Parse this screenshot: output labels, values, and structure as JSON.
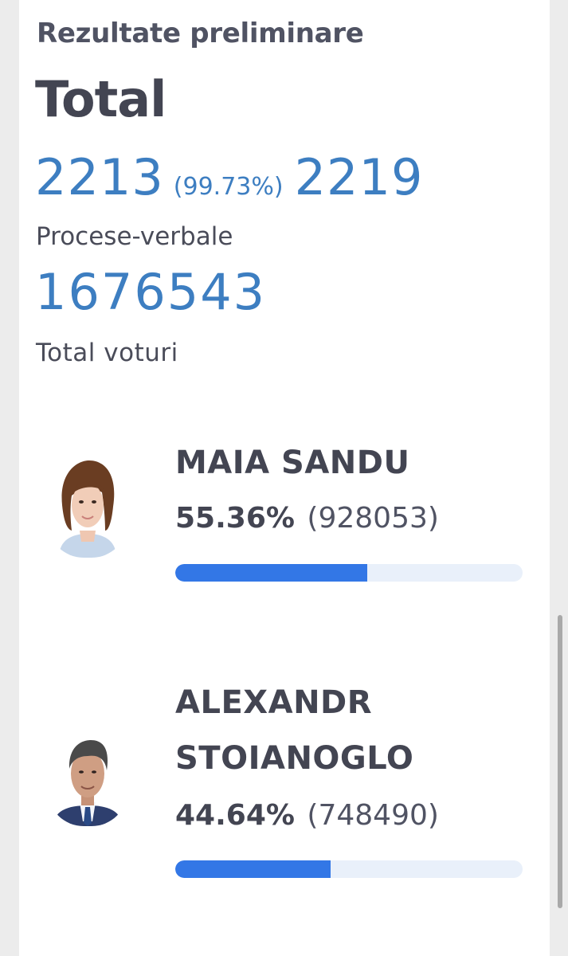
{
  "header": {
    "subtitle": "Rezultate preliminare",
    "title": "Total"
  },
  "protocols": {
    "processed": "2213",
    "percent": "(99.73%)",
    "total": "2219",
    "label": "Procese-verbale"
  },
  "votes": {
    "total": "1676543",
    "label": "Total voturi"
  },
  "candidates": [
    {
      "name_line1": "MAIA SANDU",
      "name_line2": "",
      "percent": "55.36%",
      "votes": "(928053)",
      "share": 55.36,
      "icon": "female-candidate-portrait"
    },
    {
      "name_line1": "ALEXANDR",
      "name_line2": "STOIANOGLO",
      "percent": "44.64%",
      "votes": "(748490)",
      "share": 44.64,
      "icon": "male-candidate-portrait"
    }
  ],
  "colors": {
    "accent": "#3d7ec1",
    "bar_fill": "#3377e6",
    "bar_track": "#e9f0fa",
    "text_dark": "#434552"
  }
}
